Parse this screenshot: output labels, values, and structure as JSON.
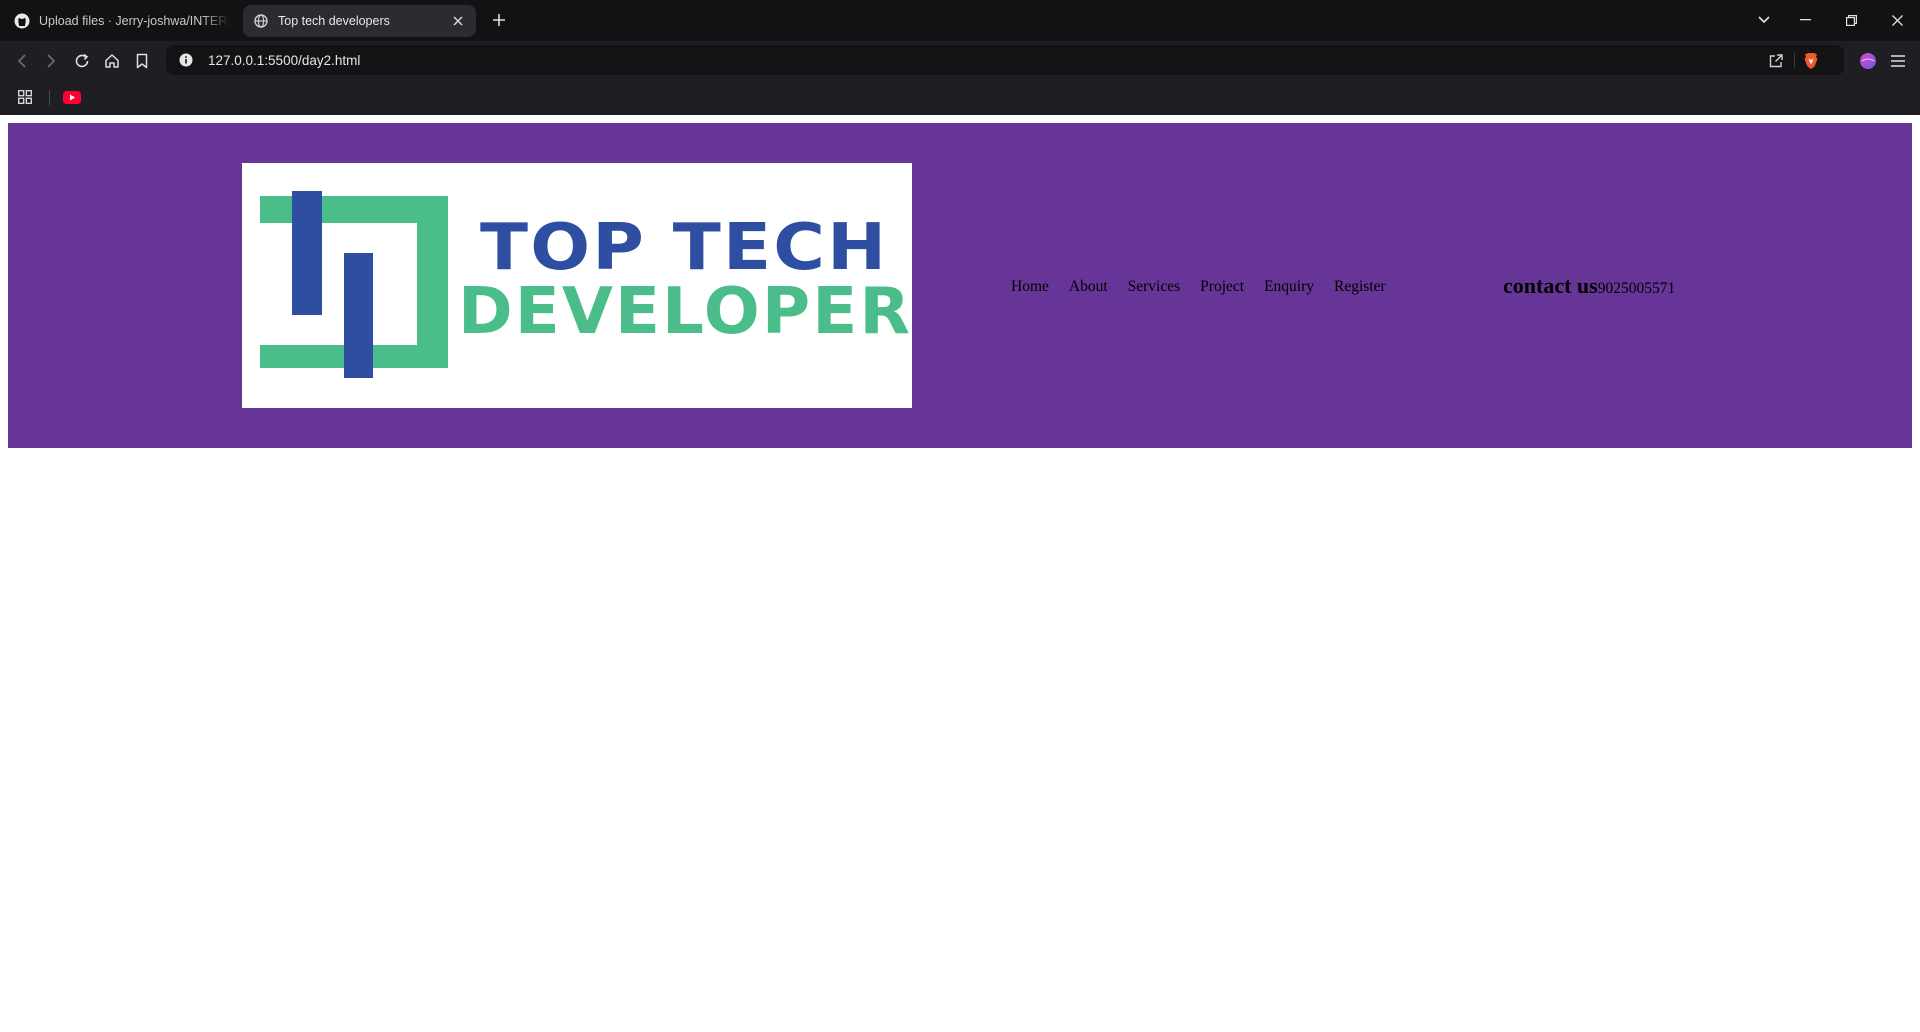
{
  "browser": {
    "tabs": [
      {
        "title": "Upload files · Jerry-joshwa/INTERN-",
        "icon": "github-icon",
        "active": false
      },
      {
        "title": "Top tech developers",
        "icon": "globe-icon",
        "active": true
      }
    ],
    "url": "127.0.0.1:5500/day2.html",
    "bookmarks": [
      {
        "icon": "apps-grid-icon"
      },
      {
        "icon": "youtube-icon"
      }
    ],
    "colors": {
      "tabbar": "#121214",
      "toolbar": "#1f1f23",
      "urlbar": "#131316"
    }
  },
  "page": {
    "header_bg": "#673597",
    "logo": {
      "line1": "TOP TECH",
      "line2": "DEVELOPER",
      "color_blue": "#2e4fa1",
      "color_green": "#4bbd8a"
    },
    "nav": [
      "Home",
      "About",
      "Services",
      "Project",
      "Enquiry",
      "Register"
    ],
    "contact": {
      "label": "contact us",
      "phone": "9025005571"
    }
  }
}
